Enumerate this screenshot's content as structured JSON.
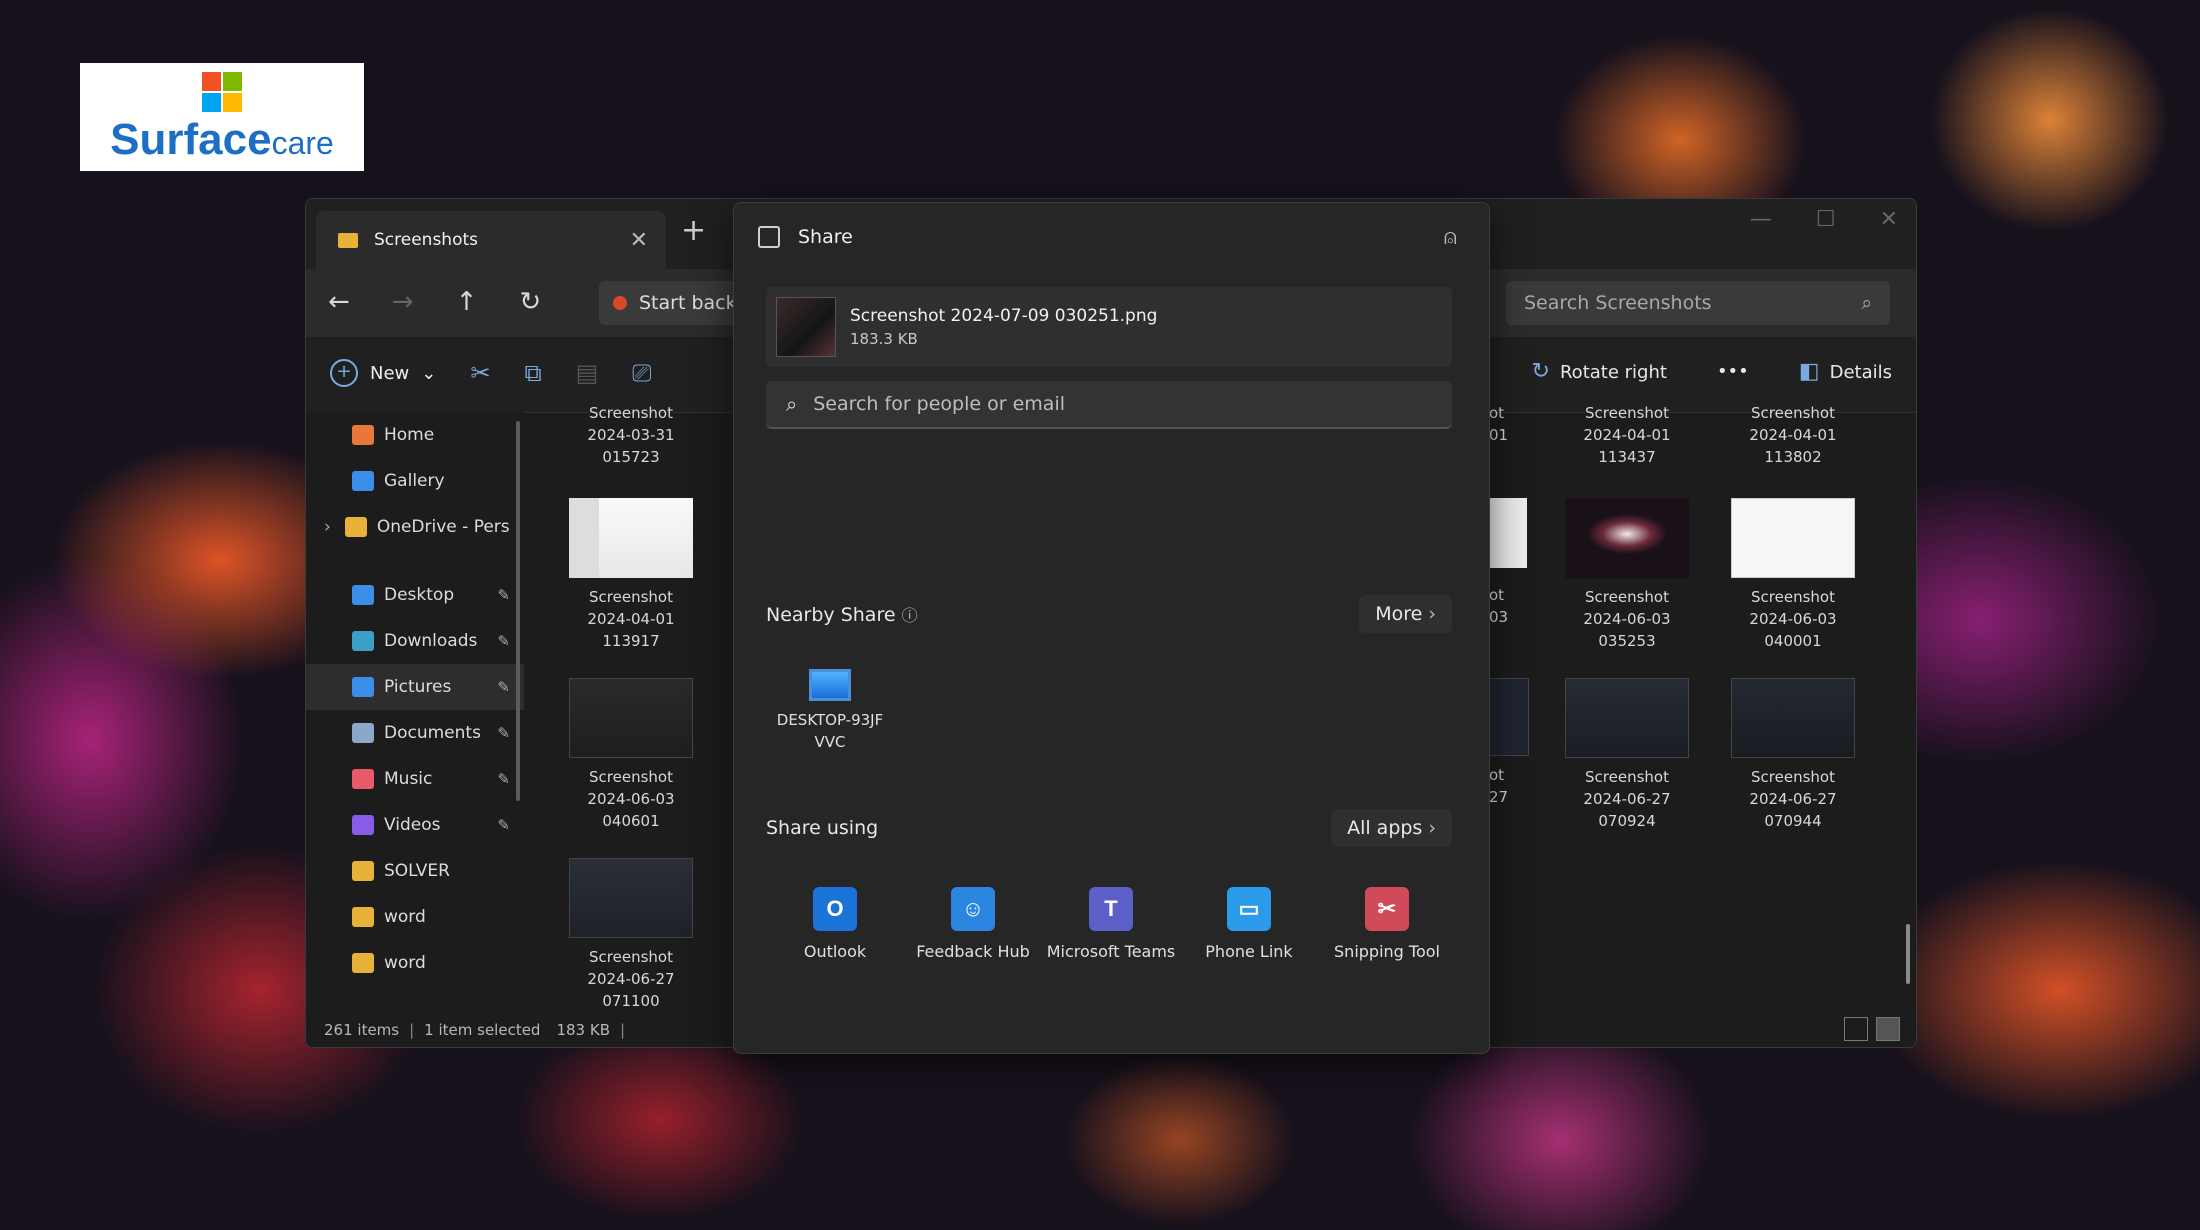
{
  "brand": {
    "name": "Surface",
    "suffix": "care",
    "colors": [
      "#f25022",
      "#7fba00",
      "#00a4ef",
      "#ffb900"
    ]
  },
  "explorer": {
    "tab_title": "Screenshots",
    "path_text": "Start back",
    "search_placeholder": "Search Screenshots",
    "commands": {
      "new": "New",
      "rotate_right": "Rotate right",
      "more": "•••",
      "details": "Details"
    },
    "sidebar": [
      {
        "label": "Home",
        "icon": "home-icon",
        "color": "#e8773a",
        "pinned": false
      },
      {
        "label": "Gallery",
        "icon": "gallery-icon",
        "color": "#3a8ee8",
        "pinned": false
      },
      {
        "label": "OneDrive - Pers",
        "icon": "onedrive-folder-icon",
        "color": "#e8b23a",
        "pinned": false
      },
      {
        "label": "Desktop",
        "icon": "desktop-icon",
        "color": "#3a8ee8",
        "pinned": true
      },
      {
        "label": "Downloads",
        "icon": "downloads-icon",
        "color": "#3aa0c8",
        "pinned": true
      },
      {
        "label": "Pictures",
        "icon": "pictures-icon",
        "color": "#3a8ee8",
        "pinned": true
      },
      {
        "label": "Documents",
        "icon": "documents-icon",
        "color": "#8aa8c8",
        "pinned": true
      },
      {
        "label": "Music",
        "icon": "music-icon",
        "color": "#e85a6a",
        "pinned": true
      },
      {
        "label": "Videos",
        "icon": "videos-icon",
        "color": "#8a5ae8",
        "pinned": true
      },
      {
        "label": "SOLVER",
        "icon": "folder-icon",
        "color": "#e8b23a",
        "pinned": false
      },
      {
        "label": "word",
        "icon": "folder-icon",
        "color": "#e8b23a",
        "pinned": false
      },
      {
        "label": "word",
        "icon": "folder-icon",
        "color": "#e8b23a",
        "pinned": false
      }
    ],
    "thumbnails_left": [
      {
        "name": "Screenshot",
        "date": "2024-03-31",
        "time": "015723"
      },
      {
        "name": "Screenshot",
        "date": "2024-04-01",
        "time": "113917"
      },
      {
        "name": "Screenshot",
        "date": "2024-06-03",
        "time": "040601"
      },
      {
        "name": "Screenshot",
        "date": "2024-06-27",
        "time": "071100"
      }
    ],
    "thumbnails_right_a": [
      {
        "name": "Screenshot",
        "date": "2024-04-01",
        "time": "113437"
      },
      {
        "name": "Screenshot",
        "date": "2024-06-03",
        "time": "035253"
      },
      {
        "name": "Screenshot",
        "date": "2024-06-27",
        "time": "070924"
      }
    ],
    "thumbnails_right_b": [
      {
        "name": "Screenshot",
        "date": "2024-04-01",
        "time": "113802"
      },
      {
        "name": "Screenshot",
        "date": "2024-06-03",
        "time": "040001"
      },
      {
        "name": "Screenshot",
        "date": "2024-06-27",
        "time": "070944"
      }
    ],
    "partial_labels": [
      "ot",
      "01",
      "ot",
      "03",
      "ot",
      "27"
    ],
    "status": {
      "items": "261 items",
      "selected": "1 item selected",
      "size": "183 KB"
    }
  },
  "share": {
    "title": "Share",
    "file": {
      "name": "Screenshot 2024-07-09 030251.png",
      "size": "183.3 KB"
    },
    "search_placeholder": "Search for people or email",
    "nearby": {
      "label": "Nearby Share",
      "more": "More",
      "device_line1": "DESKTOP-93JF",
      "device_line2": "VVC"
    },
    "share_using": {
      "label": "Share using",
      "all_apps": "All apps"
    },
    "apps": [
      {
        "label": "Outlook",
        "icon": "outlook-icon",
        "glyph": "O",
        "color": "#1a73d8"
      },
      {
        "label": "Feedback Hub",
        "icon": "feedback-hub-icon",
        "glyph": "☺",
        "color": "#2a86e0"
      },
      {
        "label": "Microsoft Teams",
        "icon": "teams-icon",
        "glyph": "T",
        "color": "#5b5fc7"
      },
      {
        "label": "Phone Link",
        "icon": "phone-link-icon",
        "glyph": "▭",
        "color": "#2b9ae8"
      },
      {
        "label": "Snipping Tool",
        "icon": "snipping-tool-icon",
        "glyph": "✂",
        "color": "#d04a5a"
      }
    ]
  }
}
